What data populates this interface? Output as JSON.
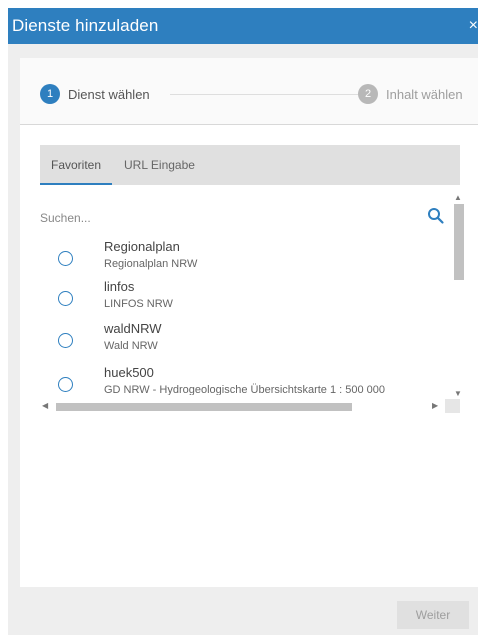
{
  "dialog": {
    "title": "Dienste hinzuladen",
    "close_glyph": "×"
  },
  "stepper": {
    "steps": [
      {
        "number": "1",
        "label": "Dienst wählen",
        "state": "active"
      },
      {
        "number": "2",
        "label": "Inhalt wählen",
        "state": "inactive"
      }
    ]
  },
  "tabs": [
    {
      "label": "Favoriten",
      "active": true
    },
    {
      "label": "URL Eingabe",
      "active": false
    }
  ],
  "search": {
    "placeholder": "Suchen...",
    "value": "",
    "icon": "search-icon"
  },
  "services": [
    {
      "name": "Regionalplan",
      "description": "Regionalplan NRW",
      "selected": false
    },
    {
      "name": "linfos",
      "description": "LINFOS NRW",
      "selected": false
    },
    {
      "name": "waldNRW",
      "description": "Wald NRW",
      "selected": false
    },
    {
      "name": "huek500",
      "description": "GD NRW - Hydrogeologische Übersichtskarte 1 : 500 000",
      "selected": false
    }
  ],
  "footer": {
    "next_label": "Weiter",
    "next_enabled": false
  },
  "colors": {
    "accent": "#2e7fbf",
    "inactive_step": "#b8b8b8"
  }
}
